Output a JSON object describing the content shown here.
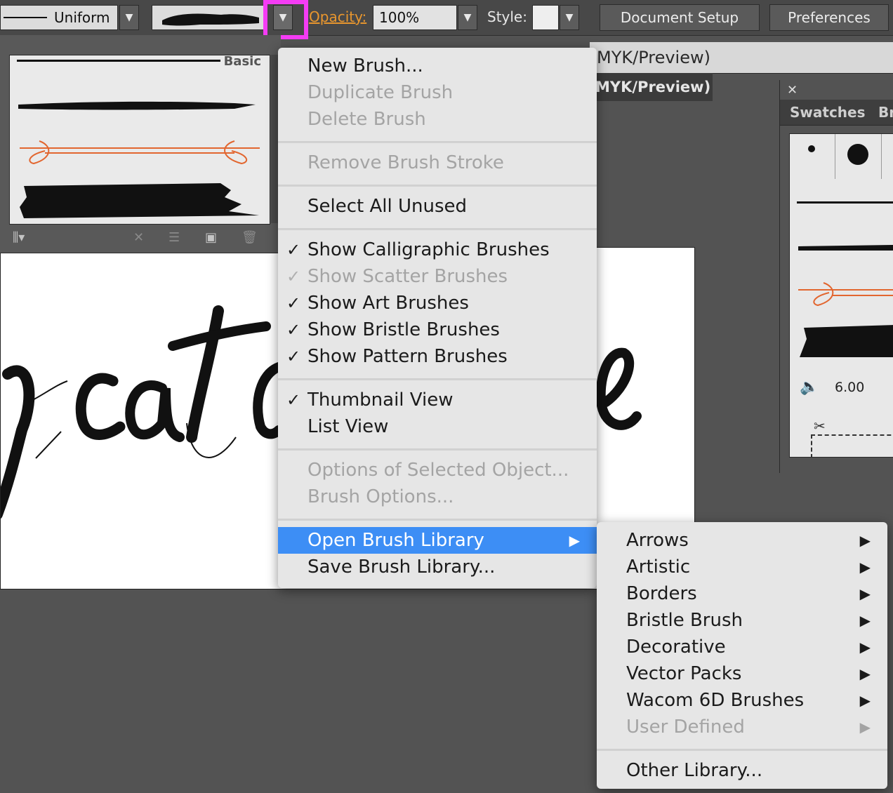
{
  "control_bar": {
    "stroke_profile_label": "Uniform",
    "opacity_label": "Opacity:",
    "opacity_value": "100%",
    "style_label": "Style:",
    "document_setup_label": "Document Setup",
    "preferences_label": "Preferences",
    "colors": {
      "opacity_label": "#e8962e",
      "highlight": "#f43cf4"
    }
  },
  "brush_panel": {
    "first_brush_name": "Basic",
    "accent_color": "#e2662f"
  },
  "document": {
    "window_title": "MYK/Preview)",
    "tab_title": "MYK/Preview)"
  },
  "right_panel": {
    "close_glyph": "✕",
    "tabs": [
      "Swatches",
      "Br"
    ],
    "stroke_weight_value": "6.00"
  },
  "flyout_menu": {
    "items": [
      {
        "label": "New Brush...",
        "enabled": true
      },
      {
        "label": "Duplicate Brush",
        "enabled": false
      },
      {
        "label": "Delete Brush",
        "enabled": false
      },
      {
        "label": "Remove Brush Stroke",
        "enabled": false
      },
      {
        "label": "Select All Unused",
        "enabled": true
      },
      {
        "label": "Show Calligraphic Brushes",
        "enabled": true,
        "checked": true
      },
      {
        "label": "Show Scatter Brushes",
        "enabled": false,
        "checked": true
      },
      {
        "label": "Show Art Brushes",
        "enabled": true,
        "checked": true
      },
      {
        "label": "Show Bristle Brushes",
        "enabled": true,
        "checked": true
      },
      {
        "label": "Show Pattern Brushes",
        "enabled": true,
        "checked": true
      },
      {
        "label": "Thumbnail View",
        "enabled": true,
        "checked": true
      },
      {
        "label": "List View",
        "enabled": true
      },
      {
        "label": "Options of Selected Object...",
        "enabled": false
      },
      {
        "label": "Brush Options...",
        "enabled": false
      },
      {
        "label": "Open Brush Library",
        "enabled": true,
        "active": true,
        "has_submenu": true
      },
      {
        "label": "Save Brush Library...",
        "enabled": true
      }
    ],
    "check_glyph": "✓",
    "submenu_arrow": "▶",
    "active_color": "#3d8ef5"
  },
  "submenu": {
    "items": [
      {
        "label": "Arrows",
        "enabled": true
      },
      {
        "label": "Artistic",
        "enabled": true
      },
      {
        "label": "Borders",
        "enabled": true
      },
      {
        "label": "Bristle Brush",
        "enabled": true
      },
      {
        "label": "Decorative",
        "enabled": true
      },
      {
        "label": "Vector Packs",
        "enabled": true
      },
      {
        "label": "Wacom 6D Brushes",
        "enabled": true
      },
      {
        "label": "User Defined",
        "enabled": false
      },
      {
        "label": "Other Library...",
        "enabled": true
      }
    ]
  }
}
